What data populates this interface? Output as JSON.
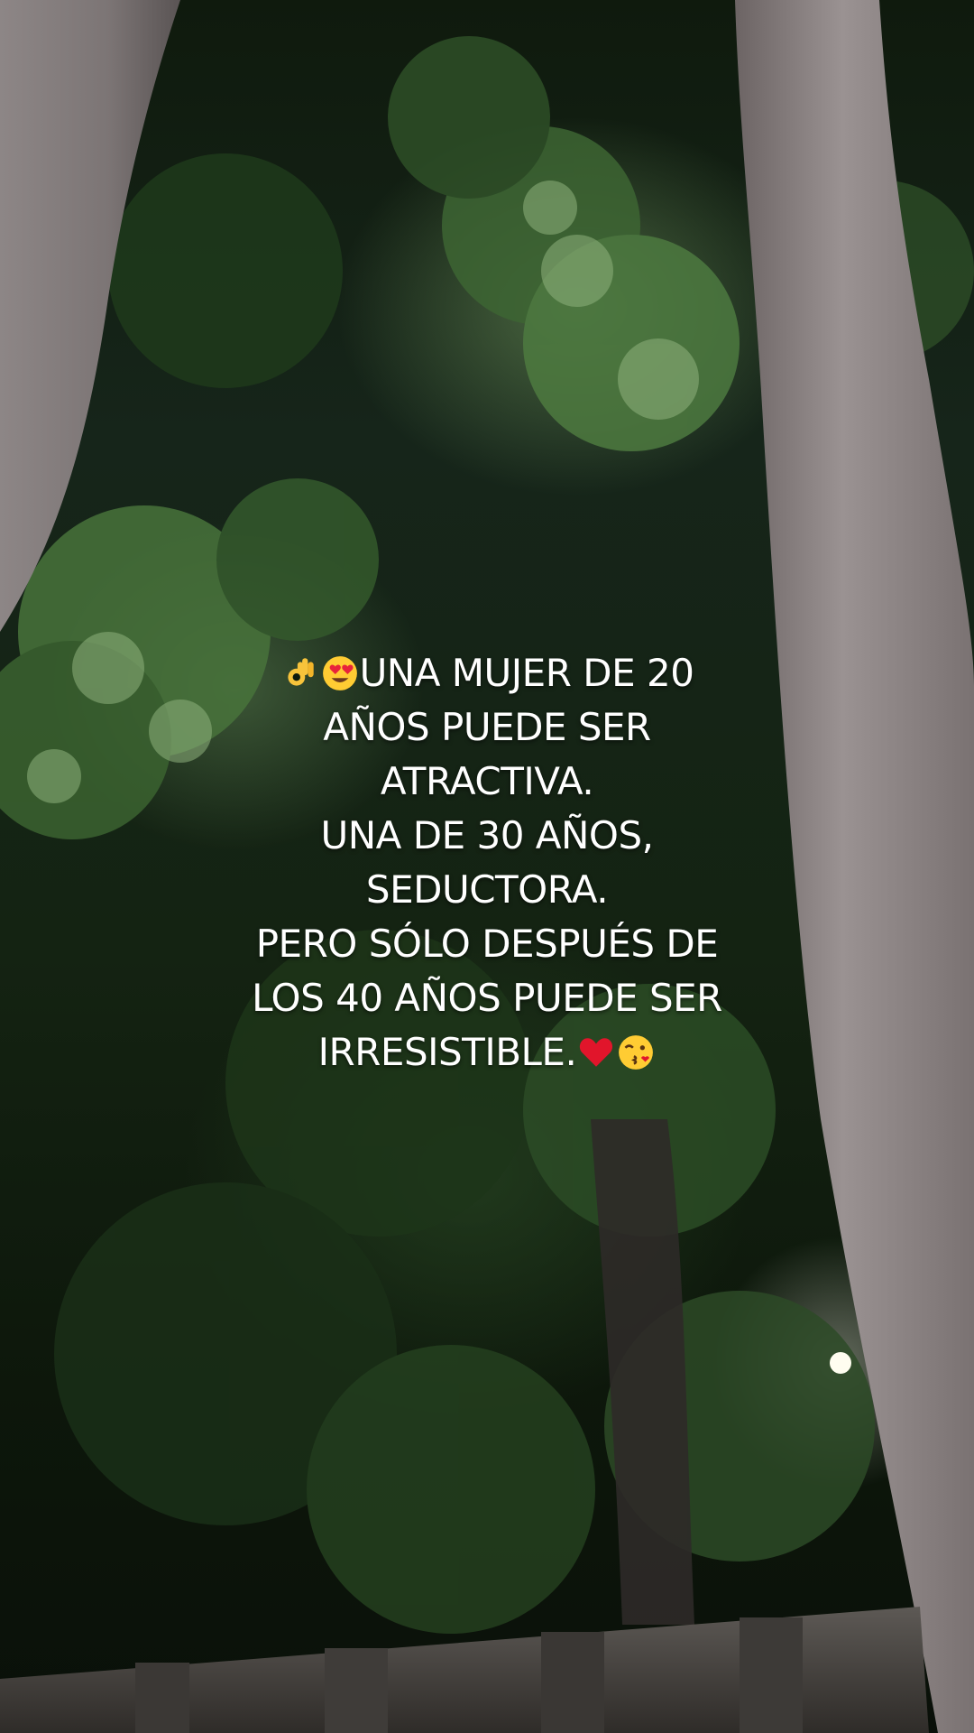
{
  "caption": {
    "lines": [
      "UNA MUJER DE 20",
      "AÑOS PUEDE SER",
      "ATRACTIVA.",
      "UNA DE 30 AÑOS,",
      "SEDUCTORA.",
      "PERO SÓLO DESPUÉS DE",
      "LOS 40 AÑOS PUEDE SER",
      "IRRESISTIBLE."
    ]
  },
  "emojis": {
    "lead": [
      "ok-hand-icon",
      "heart-eyes-icon"
    ],
    "trail": [
      "red-heart-icon",
      "kissing-face-icon"
    ]
  },
  "colors": {
    "text": "#ffffff",
    "foliage": "#3f6a36",
    "bark": "#8a8383"
  }
}
